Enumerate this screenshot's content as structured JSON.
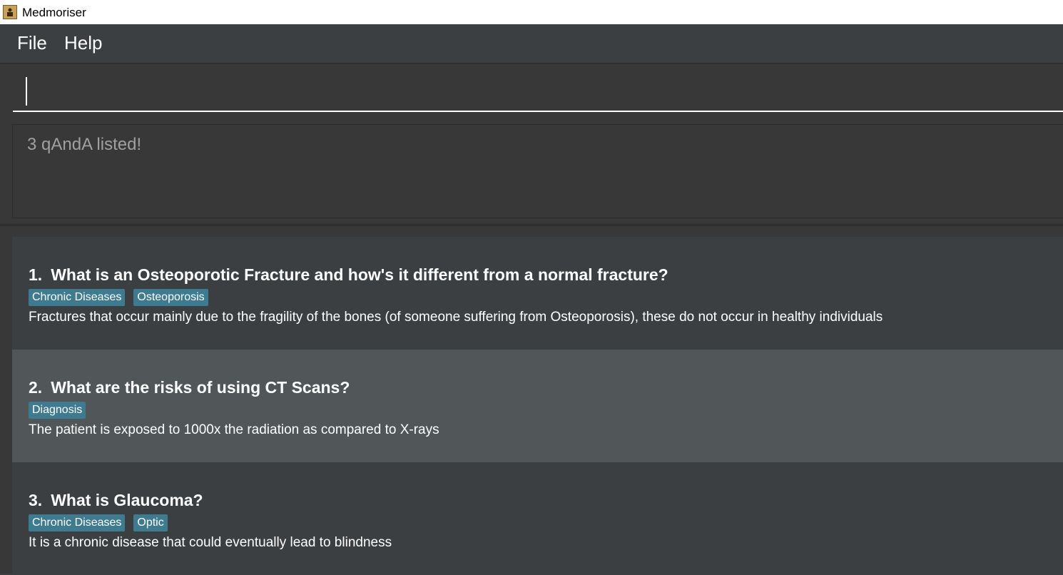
{
  "window": {
    "title": "Medmoriser",
    "icon": "app-logo-icon"
  },
  "menu": {
    "items": [
      "File",
      "Help"
    ]
  },
  "command": {
    "value": "",
    "placeholder": ""
  },
  "result": {
    "text": "3 qAndA listed!"
  },
  "colors": {
    "background": "#3c3f41",
    "selected_card": "#515658",
    "tag": "#3e7b91",
    "text": "#ffffff",
    "result_text": "#a0a0a0"
  },
  "list": {
    "cards": [
      {
        "index": "1.",
        "question": "What is an Osteoporotic Fracture and how's it different from a normal fracture?",
        "tags": [
          "Chronic Diseases",
          "Osteoporosis"
        ],
        "answer": "Fractures that occur mainly due to the fragility of the bones (of someone suffering from Osteoporosis), these do not occur in healthy individuals"
      },
      {
        "index": "2.",
        "question": "What are the risks of using CT Scans?",
        "tags": [
          "Diagnosis"
        ],
        "answer": "The patient is exposed to 1000x the radiation as compared to X-rays"
      },
      {
        "index": "3.",
        "question": "What is Glaucoma?",
        "tags": [
          "Chronic Diseases",
          "Optic"
        ],
        "answer": "It is a chronic disease that could eventually lead to blindness"
      }
    ]
  }
}
